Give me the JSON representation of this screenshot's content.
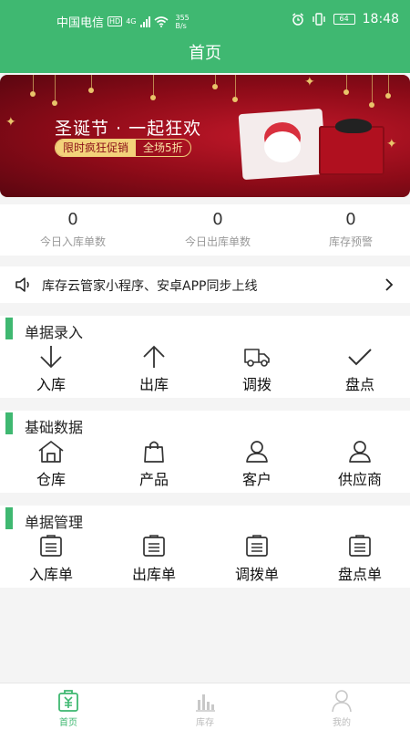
{
  "status_bar": {
    "carrier": "中国电信",
    "hd_badge": "HD",
    "network_type": "4G",
    "speed_value": "355",
    "speed_unit": "B/s",
    "battery": "64",
    "time": "18:48"
  },
  "header": {
    "title": "首页"
  },
  "banner": {
    "title": "圣诞节 · 一起狂欢",
    "promo_left": "限时疯狂促销",
    "promo_right": "全场5折"
  },
  "stats": [
    {
      "value": "0",
      "label": "今日入库单数"
    },
    {
      "value": "0",
      "label": "今日出库单数"
    },
    {
      "value": "0",
      "label": "库存预警"
    }
  ],
  "notice": {
    "text": "库存云管家小程序、安卓APP同步上线"
  },
  "sections": [
    {
      "title": "单据录入",
      "items": [
        {
          "label": "入库",
          "icon": "arrow-down-icon"
        },
        {
          "label": "出库",
          "icon": "arrow-up-icon"
        },
        {
          "label": "调拨",
          "icon": "truck-icon"
        },
        {
          "label": "盘点",
          "icon": "check-icon"
        }
      ]
    },
    {
      "title": "基础数据",
      "items": [
        {
          "label": "仓库",
          "icon": "warehouse-icon"
        },
        {
          "label": "产品",
          "icon": "shopping-bag-icon"
        },
        {
          "label": "客户",
          "icon": "user-icon"
        },
        {
          "label": "供应商",
          "icon": "user-icon"
        }
      ]
    },
    {
      "title": "单据管理",
      "items": [
        {
          "label": "入库单",
          "icon": "document-list-icon"
        },
        {
          "label": "出库单",
          "icon": "document-list-icon"
        },
        {
          "label": "调拨单",
          "icon": "document-list-icon"
        },
        {
          "label": "盘点单",
          "icon": "document-list-icon"
        }
      ]
    }
  ],
  "tabbar": [
    {
      "label": "首页",
      "icon": "home-yuan-icon",
      "active": true
    },
    {
      "label": "库存",
      "icon": "bar-chart-icon",
      "active": false
    },
    {
      "label": "我的",
      "icon": "user-icon",
      "active": false
    }
  ],
  "colors": {
    "primary": "#3fb871",
    "inactive_tab": "#bdbdbd",
    "banner_red": "#b0101f"
  }
}
